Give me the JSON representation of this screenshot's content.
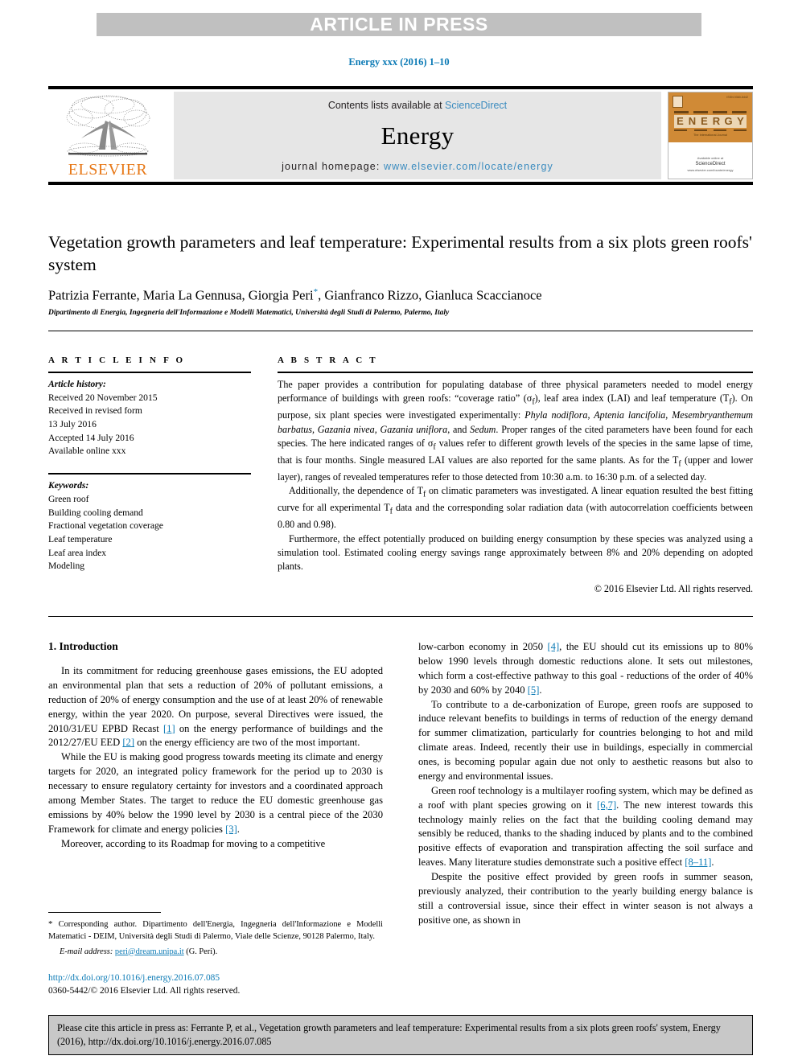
{
  "banner": {
    "label": "ARTICLE IN PRESS"
  },
  "running_head": "Energy xxx (2016) 1–10",
  "masthead": {
    "contents_prefix": "Contents lists available at ",
    "contents_link": "ScienceDirect",
    "journal_name": "Energy",
    "homepage_prefix": "journal homepage: ",
    "homepage_link": "www.elsevier.com/locate/energy",
    "publisher_wordmark": "ELSEVIER",
    "cover": {
      "issn": "ISSN 0360-5442",
      "title_letters": [
        "E",
        "N",
        "E",
        "R",
        "G",
        "Y"
      ],
      "tagline": "The International Journal",
      "publisher_small": "Available online at",
      "publisher_name": "ScienceDirect",
      "publisher_url": "www.elsevier.com/locate/energy"
    }
  },
  "article": {
    "title": "Vegetation growth parameters and leaf temperature: Experimental results from a six plots green roofs' system",
    "authors": "Patrizia Ferrante, Maria La Gennusa, Giorgia Peri",
    "author_marker": "*",
    "authors_rest": ", Gianfranco Rizzo, Gianluca Scaccianoce",
    "affiliation": "Dipartimento di Energia, Ingegneria dell'Informazione e Modelli Matematici, Università degli Studi di Palermo, Palermo, Italy"
  },
  "article_info": {
    "heading": "A R T I C L E  I N F O",
    "history_label": "Article history:",
    "history": [
      "Received 20 November 2015",
      "Received in revised form",
      "13 July 2016",
      "Accepted 14 July 2016",
      "Available online xxx"
    ],
    "keywords_label": "Keywords:",
    "keywords": [
      "Green roof",
      "Building cooling demand",
      "Fractional vegetation coverage",
      "Leaf temperature",
      "Leaf area index",
      "Modeling"
    ]
  },
  "abstract": {
    "heading": "A B S T R A C T",
    "p1_a": "The paper provides a contribution for populating database of three physical parameters needed to model energy performance of buildings with green roofs: “coverage ratio” (σ",
    "p1_sub1": "f",
    "p1_b": "), leaf area index (LAI) and leaf temperature (T",
    "p1_sub2": "f",
    "p1_c": "). On purpose, six plant species were investigated experimentally: ",
    "species": "Phyla nodiflora, Aptenia lancifolia, Mesembryanthemum barbatus, Gazania nivea, Gazania uniflora",
    "p1_d": ", and ",
    "species_last": "Sedum",
    "p1_e": ". Proper ranges of the cited parameters have been found for each species. The here indicated ranges of σ",
    "p1_sub3": "f",
    "p1_f": " values refer to different growth levels of the species in the same lapse of time, that is four months. Single measured LAI values are also reported for the same plants. As for the T",
    "p1_sub4": "f",
    "p1_g": " (upper and lower layer), ranges of revealed temperatures refer to those detected from 10:30 a.m. to 16:30 p.m. of a selected day.",
    "p2_a": "Additionally, the dependence of T",
    "p2_sub1": "f",
    "p2_b": " on climatic parameters was investigated. A linear equation resulted the best fitting curve for all experimental T",
    "p2_sub2": "f",
    "p2_c": " data and the corresponding solar radiation data (with autocorrelation coefficients between 0.80 and 0.98).",
    "p3": "Furthermore, the effect potentially produced on building energy consumption by these species was analyzed using a simulation tool. Estimated cooling energy savings range approximately between 8% and 20% depending on adopted plants.",
    "copyright": "© 2016 Elsevier Ltd. All rights reserved."
  },
  "intro": {
    "section_title": "1. Introduction",
    "left": {
      "p1_a": "In its commitment for reducing greenhouse gases emissions, the EU adopted an environmental plan that sets a reduction of 20% of pollutant emissions, a reduction of 20% of energy consumption and the use of at least 20% of renewable energy, within the year 2020. On purpose, several Directives were issued, the 2010/31/EU EPBD Recast ",
      "p1_ref1": "[1]",
      "p1_b": " on the energy performance of buildings and the 2012/27/EU EED ",
      "p1_ref2": "[2]",
      "p1_c": " on the energy efficiency are two of the most important.",
      "p2_a": "While the EU is making good progress towards meeting its climate and energy targets for 2020, an integrated policy framework for the period up to 2030 is necessary to ensure regulatory certainty for investors and a coordinated approach among Member States. The target to reduce the EU domestic greenhouse gas emissions by 40% below the 1990 level by 2030 is a central piece of the 2030 Framework for climate and energy policies ",
      "p2_ref1": "[3]",
      "p2_b": ".",
      "p3": "Moreover, according to its Roadmap for moving to a competitive"
    },
    "right": {
      "p1_a": "low-carbon economy in 2050 ",
      "p1_ref1": "[4]",
      "p1_b": ", the EU should cut its emissions up to 80% below 1990 levels through domestic reductions alone. It sets out milestones, which form a cost-effective pathway to this goal - reductions of the order of 40% by 2030 and 60% by 2040 ",
      "p1_ref2": "[5]",
      "p1_c": ".",
      "p2": "To contribute to a de-carbonization of Europe, green roofs are supposed to induce relevant benefits to buildings in terms of reduction of the energy demand for summer climatization, particularly for countries belonging to hot and mild climate areas. Indeed, recently their use in buildings, especially in commercial ones, is becoming popular again due not only to aesthetic reasons but also to energy and environmental issues.",
      "p3_a": "Green roof technology is a multilayer roofing system, which may be defined as a roof with plant species growing on it ",
      "p3_ref1": "[6,7]",
      "p3_b": ". The new interest towards this technology mainly relies on the fact that the building cooling demand may sensibly be reduced, thanks to the shading induced by plants and to the combined positive effects of evaporation and transpiration affecting the soil surface and leaves. Many literature studies demonstrate such a positive effect ",
      "p3_ref2": "[8–11]",
      "p3_c": ".",
      "p4": "Despite the positive effect provided by green roofs in summer season, previously analyzed, their contribution to the yearly building energy balance is still a controversial issue, since their effect in winter season is not always a positive one, as shown in"
    }
  },
  "footnote": {
    "star": "*",
    "corresponding": " Corresponding author. Dipartimento dell'Energia, Ingegneria dell'Informazione e Modelli Matematici - DEIM, Università degli Studi di Palermo, Viale delle Scienze, 90128 Palermo, Italy.",
    "email_label": "E-mail address:",
    "email": "peri@dream.unipa.it",
    "email_owner": " (G. Peri).",
    "doi": "http://dx.doi.org/10.1016/j.energy.2016.07.085",
    "issn_line": "0360-5442/© 2016 Elsevier Ltd. All rights reserved."
  },
  "cite_box": {
    "text": "Please cite this article in press as: Ferrante P, et al., Vegetation growth parameters and leaf temperature: Experimental results from a six plots green roofs' system, Energy (2016), http://dx.doi.org/10.1016/j.energy.2016.07.085"
  },
  "colors": {
    "link": "#3a8bbf",
    "ref": "#0b7ab5",
    "elsevier_orange": "#e77817",
    "banner_gray": "#c0c0c0",
    "masthead_gray": "#e6e6e6",
    "cite_gray": "#c8c8c8"
  }
}
